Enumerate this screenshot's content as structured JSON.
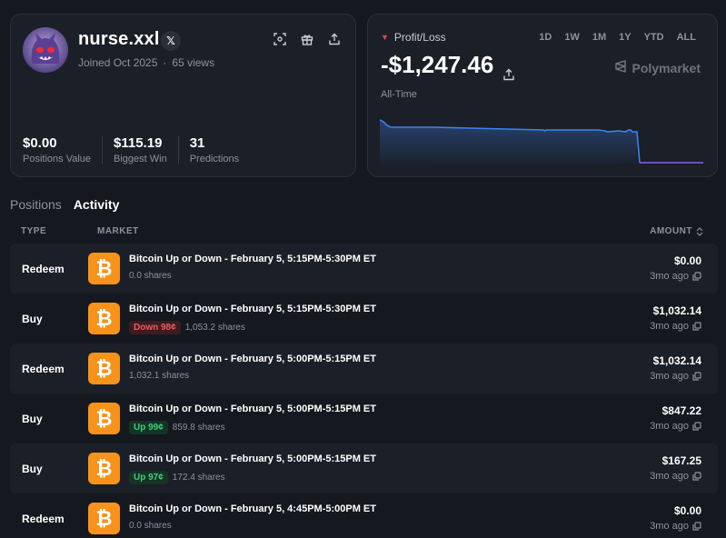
{
  "profile": {
    "username": "nurse.xxl",
    "x_label": "𝕏",
    "joined": "Joined Oct 2025",
    "views": "65 views",
    "stats": [
      {
        "value": "$0.00",
        "label": "Positions Value"
      },
      {
        "value": "$115.19",
        "label": "Biggest Win"
      },
      {
        "value": "31",
        "label": "Predictions"
      }
    ]
  },
  "pnl": {
    "label": "Profit/Loss",
    "value": "-$1,247.46",
    "ranges": [
      "1D",
      "1W",
      "1M",
      "1Y",
      "YTD",
      "ALL"
    ],
    "active_range": "ALL",
    "brand": "Polymarket",
    "subtitle": "All-Time",
    "line_before_color": "#3b82f6",
    "line_after_color": "#8b5cf6"
  },
  "tabs": [
    {
      "label": "Positions",
      "active": false
    },
    {
      "label": "Activity",
      "active": true
    }
  ],
  "table": {
    "col_type": "TYPE",
    "col_market": "MARKET",
    "col_amount": "AMOUNT",
    "rows": [
      {
        "type": "Redeem",
        "title": "Bitcoin Up or Down - February 5, 5:15PM-5:30PM ET",
        "pill": "",
        "pill_kind": "",
        "shares": "0.0 shares",
        "amount": "$0.00",
        "when": "3mo ago"
      },
      {
        "type": "Buy",
        "title": "Bitcoin Up or Down - February 5, 5:15PM-5:30PM ET",
        "pill": "Down 98¢",
        "pill_kind": "down",
        "shares": "1,053.2 shares",
        "amount": "$1,032.14",
        "when": "3mo ago"
      },
      {
        "type": "Redeem",
        "title": "Bitcoin Up or Down - February 5, 5:00PM-5:15PM ET",
        "pill": "",
        "pill_kind": "",
        "shares": "1,032.1 shares",
        "amount": "$1,032.14",
        "when": "3mo ago"
      },
      {
        "type": "Buy",
        "title": "Bitcoin Up or Down - February 5, 5:00PM-5:15PM ET",
        "pill": "Up 99¢",
        "pill_kind": "up",
        "shares": "859.8 shares",
        "amount": "$847.22",
        "when": "3mo ago"
      },
      {
        "type": "Buy",
        "title": "Bitcoin Up or Down - February 5, 5:00PM-5:15PM ET",
        "pill": "Up 97¢",
        "pill_kind": "up",
        "shares": "172.4 shares",
        "amount": "$167.25",
        "when": "3mo ago"
      },
      {
        "type": "Redeem",
        "title": "Bitcoin Up or Down - February 5, 4:45PM-5:00PM ET",
        "pill": "",
        "pill_kind": "",
        "shares": "0.0 shares",
        "amount": "$0.00",
        "when": "3mo ago"
      }
    ]
  }
}
